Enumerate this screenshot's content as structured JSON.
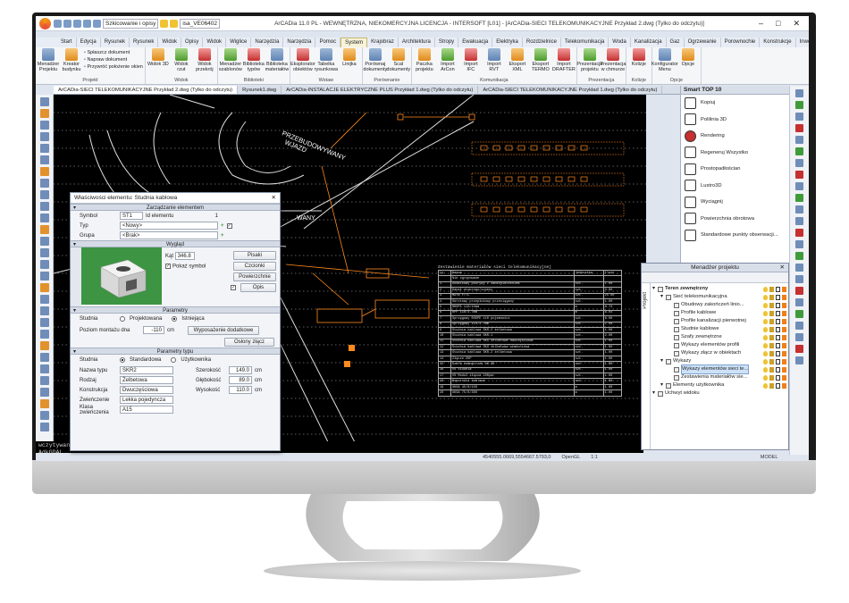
{
  "app": {
    "title": "ArCADia 11.0 PL - WEWNĘTRZNA, NIEKOMERCYJNA LICENCJA - INTERSOFT [L01] - [ArCADia-SIECI TELEKOMUNIKACYJNE Przykład 2.dwg (Tylko do odczytu)]",
    "workspace": "Szkicowanie i opisy",
    "layer_value": "isa_VE06402"
  },
  "menu_tabs": [
    "Start",
    "Edycja",
    "Rysunek 2D",
    "Rysunek 3D",
    "Widok",
    "Opisy",
    "Widok",
    "Wiglice",
    "Narzędzia",
    "Narzędzia x",
    "Pomoc",
    "System",
    "Krajobraz",
    "Architektura",
    "Stropy",
    "Ewakuacja",
    "Elektryka",
    "Rozdzielnice",
    "Telekomunikacja",
    "Woda",
    "Kanalizacja",
    "Gaz",
    "Ogrzewanie",
    "Porownochie",
    "Konstrukcje",
    "Inwentaryzacja"
  ],
  "active_tab": "System",
  "ribbon": {
    "groups": [
      {
        "name": "Projekt",
        "items": [
          "Menadżer Projektu",
          "Kreator budynku"
        ],
        "list": [
          "Spłaszcz dokument",
          "Napraw dokument",
          "Przywróć położenie okien"
        ]
      },
      {
        "name": "Widok",
        "items": [
          "Widok 3D",
          "Widok rzut",
          "Widok przekrój"
        ]
      },
      {
        "name": "Biblioteki",
        "items": [
          "Menadżer szablonów",
          "Biblioteka typów",
          "Biblioteka materiałów"
        ]
      },
      {
        "name": "Wstaw",
        "items": [
          "Eksplorator obiektów",
          "Tabelka rysunkowa",
          "Linijka"
        ]
      },
      {
        "name": "Porównanie",
        "items": [
          "Porównaj dokumenty",
          "Scal dokumenty"
        ]
      },
      {
        "name": "Komunikacja",
        "items": [
          "Paczka projektu",
          "Import ArCon",
          "Import IFC",
          "Import RVT",
          "Eksport XML",
          "Eksport TERMO",
          "Import DRAFTER"
        ]
      },
      {
        "name": "Prezentacja",
        "items": [
          "Prezentacja projektu",
          "Prezentacja w chmurze"
        ]
      },
      {
        "name": "Kolizje",
        "items": [
          "Kolizje"
        ]
      },
      {
        "name": "Opcje",
        "items": [
          "Konfigurator Menu",
          "Opcje"
        ]
      }
    ]
  },
  "doc_tabs": [
    "ArCADia-SIECI TELEKOMUNIKACYJNE Przykład 2.dwg (Tylko do odczytu)",
    "Rysunek1.dwg",
    "ArCADia-INSTALACJE ELEKTRYCZNE PLUS Przykład 1.dwg (Tylko do odczytu)",
    "ArCADia-SIECI TELEKOMUNIKACYJNE Przykład 1.dwg (Tylko do odczytu)"
  ],
  "canvas_labels": {
    "street": "PRZEBUDOWYWANY",
    "entry": "WJAZD",
    "cut": "WANY",
    "table_title": "Zestawienie materiałów sieci telekomunikacyjnej"
  },
  "material_table": {
    "headers": [
      "Lp.",
      "Nazwa",
      "Jednostka",
      "Ilość"
    ],
    "rows": [
      [
        "",
        "Nie zgrupowane",
        "",
        ""
      ],
      [
        "1",
        "Dodatkowy pokrywy z zabezpieczeniem",
        "szt.",
        "1.00"
      ],
      [
        "2",
        "Kanał otworowy/szpeny",
        "szt.",
        "3.00"
      ],
      [
        "3",
        "Mufa FTTC",
        "szt.",
        "25.00"
      ],
      [
        "4",
        "Obrotowy przepłukowy przeciągany",
        "szt.",
        "1.00"
      ],
      [
        "5",
        "RHDPE 110/10mm",
        "m",
        "8.73"
      ],
      [
        "6",
        "RPP 110/3.7mm",
        "m",
        "6.03"
      ],
      [
        "7",
        "Sprzęgowy RHDPE 110 pojemności",
        "szt.",
        "6.00"
      ],
      [
        "8",
        "Sprzęgowy 110/3.7mm",
        "szt.",
        "2.00"
      ],
      [
        "9",
        "Studnia kablowa SKR-2 żelbetowa",
        "szt.",
        "1.00"
      ],
      [
        "10",
        "Studnia kablowa SKR-1",
        "szt.",
        "2.00"
      ],
      [
        "11",
        "Studnia kablowa SKS żelbetowa dwuczęściowa",
        "szt.",
        "1.00"
      ],
      [
        "12",
        "Studnia kablowa SKS żelbetowa wzmocniona",
        "szt.",
        "1.00"
      ],
      [
        "13",
        "Studnia kablowa SKR-2 żelbetowa",
        "szt.",
        "1.00"
      ],
      [
        "14",
        "Złącze ZKP",
        "szt.",
        "1.00"
      ],
      [
        "15",
        "Szafa zewnętrzna OK 80",
        "szt.",
        "1.00"
      ],
      [
        "16",
        "VS Studnia",
        "szt.",
        "1.00"
      ],
      [
        "17",
        "VS Moduł złącza 100par",
        "szt.",
        "1.00"
      ],
      [
        "18",
        "Wsporniki kablowe",
        "szt.",
        "1.00"
      ],
      [
        "19",
        "XKSA 45/8/150",
        "m",
        "1.00"
      ],
      [
        "20",
        "XKSA 75/8/300",
        "m",
        "1.00"
      ]
    ]
  },
  "properties_dialog": {
    "title": "Właściwości elementu: Studnia kablowa",
    "sections": {
      "management": "Zarządzanie elementem",
      "appearance": "Wygląd",
      "parameters": "Parametry",
      "type_parameters": "Parametry typu"
    },
    "symbol_label": "Symbol",
    "symbol_value": "ST1",
    "element_id_label": "Id elementu",
    "element_id_value": "1",
    "type_label": "Typ",
    "type_value": "<Nowy>",
    "group_label": "Grupa",
    "group_value": "<Brak>",
    "angle_label": "Kąt",
    "angle_value": "346.8",
    "show_symbol_label": "Pokaż symbol",
    "btn_pens": "Pisaki",
    "btn_fonts": "Czcionki",
    "btn_surfaces": "Powierzchnie",
    "btn_description": "Opis",
    "well_label": "Studnia",
    "well_option_designed": "Projektowana",
    "well_option_existing": "Istniejąca",
    "mount_label": "Poziom montażu dna",
    "mount_value": "-110",
    "mount_unit": "cm",
    "btn_equipment": "Wyposażenie dodatkowe",
    "btn_covers": "Osłony złącz",
    "well_type_label": "Studnia",
    "well_type_standard": "Standardowa",
    "well_type_user": "Użytkownika",
    "type_name_label": "Nazwa typu",
    "type_name_value": "SKR2",
    "kind_label": "Rodzaj",
    "kind_value": "Żelbetowa",
    "construction_label": "Konstrukcja",
    "construction_value": "Dwuczęściowa",
    "lid_label": "Zwieńczenie",
    "lid_value": "Lekka pojedyncza",
    "lid_class_label": "Klasa zwieńczenia",
    "lid_class_value": "A15",
    "width_label": "Szerokość",
    "width_value": "149.0",
    "depth_label": "Głębokość",
    "depth_value": "89.0",
    "height_label": "Wysokość",
    "height_value": "110.0",
    "unit_cm": "cm"
  },
  "smart_panel": {
    "title": "Smart TOP 10",
    "items": [
      "Kopiuj",
      "Polilinia 3D",
      "Rendering",
      "Regeneruj Wszystko",
      "Prostopadłościan",
      "Lustro3D",
      "Wyciągnij",
      "Powierzchnia obrotowa",
      "Standardowe punkty obserwacji..."
    ]
  },
  "project_manager": {
    "title": "Menadżer projektu",
    "side_tab": "Projekt",
    "tree": [
      {
        "level": 0,
        "label": "Teren zewnętrzny",
        "bold": true
      },
      {
        "level": 1,
        "label": "Sieć telekomunikacyjna"
      },
      {
        "level": 2,
        "label": "Obudowy zakończeń linio..."
      },
      {
        "level": 2,
        "label": "Profile kablowe"
      },
      {
        "level": 2,
        "label": "Profile kanalizacji pierwotnej"
      },
      {
        "level": 2,
        "label": "Studnie kablowe"
      },
      {
        "level": 2,
        "label": "Szafy zewnętrzne"
      },
      {
        "level": 2,
        "label": "Wykazy elementów profili"
      },
      {
        "level": 2,
        "label": "Wykazy złącz w obiektach"
      },
      {
        "level": 1,
        "label": "Wykazy"
      },
      {
        "level": 2,
        "label": "Wykazy elementów sieci te...",
        "selected": true
      },
      {
        "level": 2,
        "label": "Zestawienia materiałów sie..."
      },
      {
        "level": 1,
        "label": "Elementy użytkownika"
      },
      {
        "level": 0,
        "label": "Uchwyt widoku"
      }
    ]
  },
  "command_line": [
    "wczytywanie:",
    "AdkGDAL"
  ],
  "status": {
    "coords": "4540555.0669,5554667.5793,0",
    "render": "OpenGL",
    "scale": "1:1",
    "model": "MODEL"
  },
  "colors": {
    "accent": "#f39c12",
    "canvas": "#000000",
    "cad_orange": "#ff8a1f"
  }
}
